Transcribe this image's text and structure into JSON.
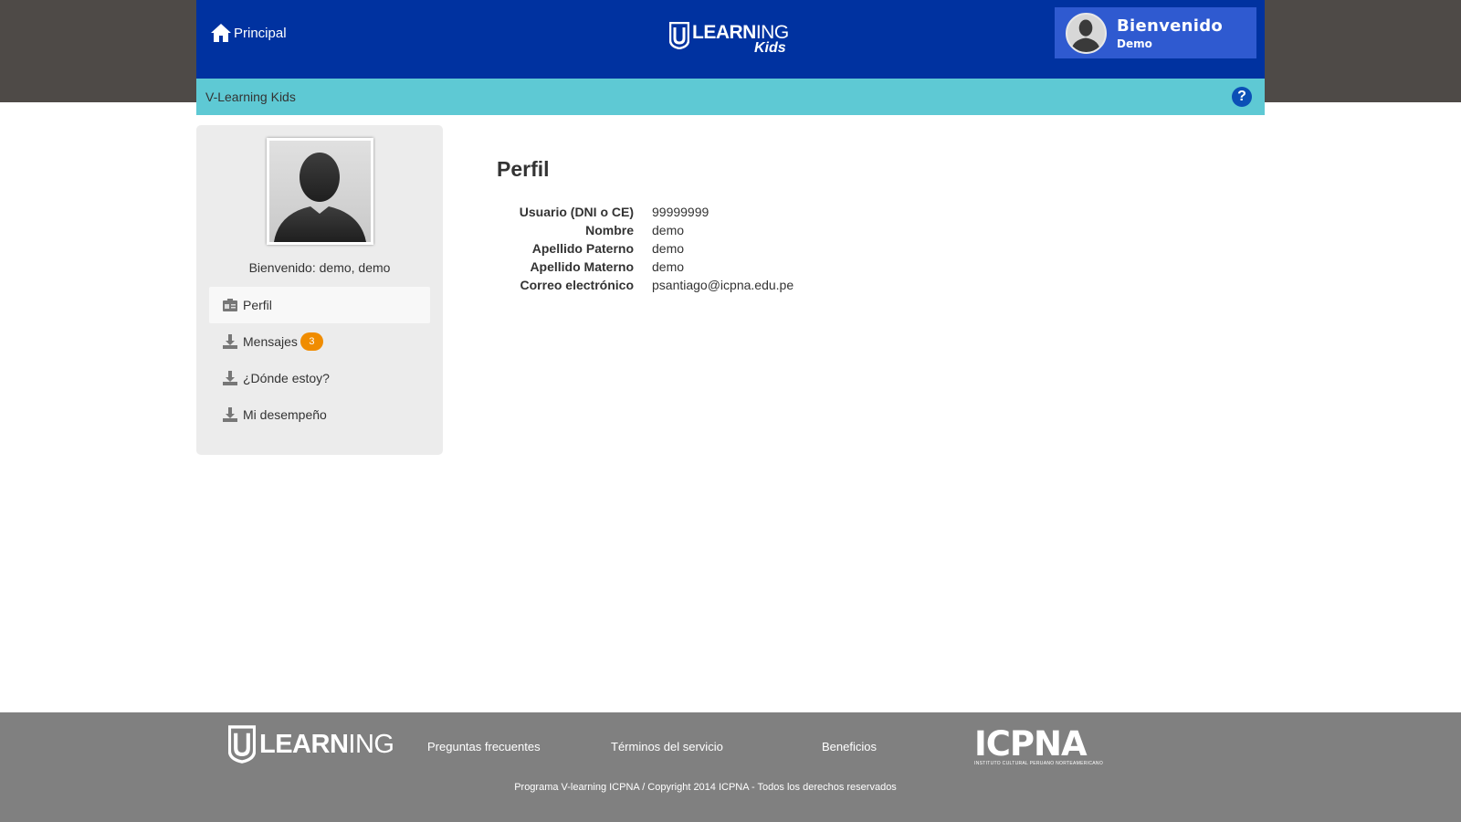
{
  "header": {
    "home_label": "Principal",
    "logo_learning": "LEARN",
    "logo_ing": "ING",
    "logo_kids": "Kids",
    "welcome_title": "Bienvenido",
    "welcome_user": "Demo"
  },
  "subbar": {
    "site_name": "V-Learning Kids",
    "help_label": "?"
  },
  "sidebar": {
    "greeting": "Bienvenido: demo, demo",
    "items": [
      {
        "label": "Perfil",
        "active": true
      },
      {
        "label": "Mensajes",
        "badge": "3"
      },
      {
        "label": "¿Dónde estoy?"
      },
      {
        "label": "Mi desempeño"
      }
    ]
  },
  "profile": {
    "title": "Perfil",
    "fields": [
      {
        "key": "Usuario (DNI o CE)",
        "value": "99999999"
      },
      {
        "key": "Nombre",
        "value": "demo"
      },
      {
        "key": "Apellido Paterno",
        "value": "demo"
      },
      {
        "key": "Apellido Materno",
        "value": "demo"
      },
      {
        "key": "Correo electrónico",
        "value": "psantiago@icpna.edu.pe"
      }
    ]
  },
  "footer": {
    "logo_learning": "LEARN",
    "logo_ing": "ING",
    "links": [
      "Preguntas frecuentes",
      "Términos del servicio",
      "Beneficios"
    ],
    "partner": "ICPNA",
    "partner_sub": "INSTITUTO CULTURAL PERUANO NORTEAMERICANO",
    "copyright": "Programa V-learning ICPNA / Copyright 2014 ICPNA - Todos los derechos reservados"
  },
  "colors": {
    "header_bg": "#0032a0",
    "subbar_bg": "#5ec9d4",
    "badge": "#f08c00",
    "footer_bg": "#808080"
  }
}
